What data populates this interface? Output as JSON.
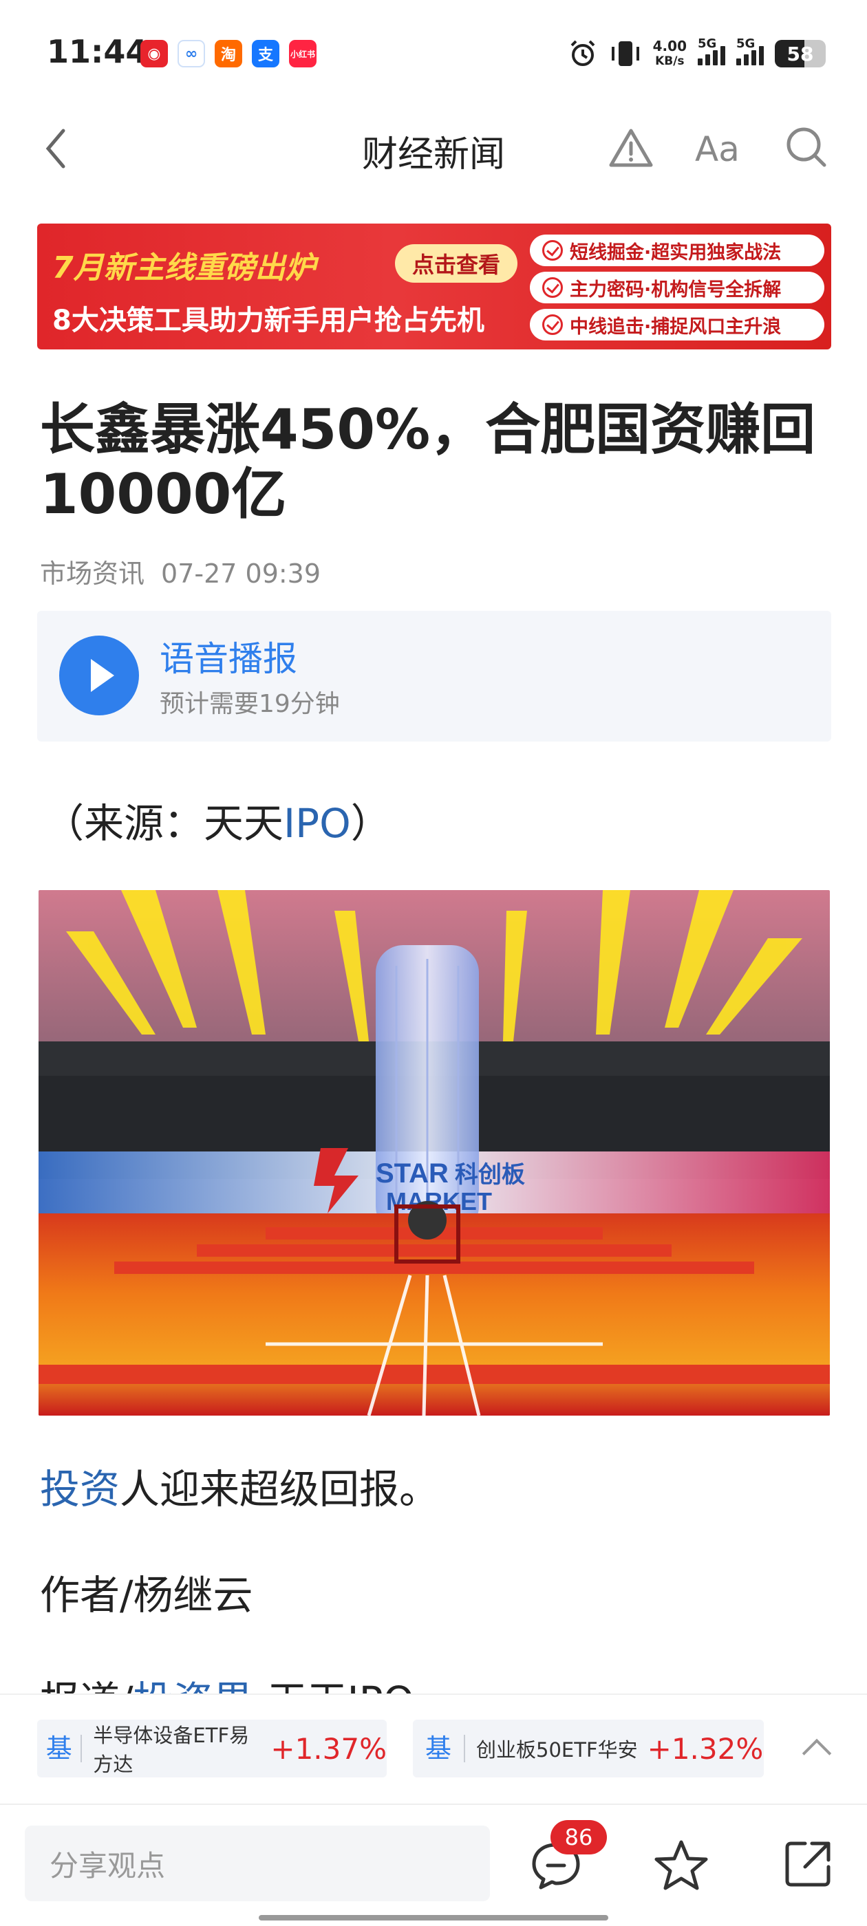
{
  "status_bar": {
    "time": "11:44",
    "apps": [
      {
        "icon": "netease-music-icon",
        "color": "#e8242c",
        "glyph": "◉"
      },
      {
        "icon": "infinity-app-icon",
        "color": "#ffffff",
        "glyph": "∞"
      },
      {
        "icon": "taobao-icon",
        "color": "#ff6a00",
        "glyph": "淘"
      },
      {
        "icon": "alipay-icon",
        "color": "#1677ff",
        "glyph": "支"
      },
      {
        "icon": "xiaohongshu-icon",
        "color": "#ff2442",
        "glyph": "小红书"
      }
    ],
    "net_speed_value": "4.00",
    "net_speed_unit": "KB/s",
    "signal1_label": "5G",
    "signal2_label": "5G",
    "battery_level": "58"
  },
  "nav": {
    "title": "财经新闻"
  },
  "banner": {
    "line1": "7月新主线重磅出炉",
    "button": "点击查看",
    "line2": "8大决策工具助力新手用户抢占先机",
    "pills": [
      "短线掘金·超实用独家战法",
      "主力密码·机构信号全拆解",
      "中线追击·捕捉风口主升浪"
    ]
  },
  "article": {
    "headline": "长鑫暴涨450%，合肥国资赚回10000亿",
    "source": "市场资讯",
    "datetime": "07-27 09:39",
    "audio_title": "语音播报",
    "audio_duration": "预计需要19分钟",
    "source_prefix": "（来源：天天",
    "source_link": "IPO",
    "source_suffix": "）",
    "photo_text_star": "STAR",
    "photo_text_kcb": "科创板",
    "photo_text_market": "MARKET",
    "p1_link": "投资",
    "p1_text": "人迎来超级回报。",
    "p2_text": "作者/杨继云",
    "p3_prefix": "报道/",
    "p3_link": "投资界",
    "p3_suffix": "-天天IPO"
  },
  "ticker": {
    "items": [
      {
        "tag": "基",
        "name": "半导体设备ETF易方达",
        "change": "+1.37%"
      },
      {
        "tag": "基",
        "name": "创业板50ETF华安",
        "change": "+1.32%"
      }
    ]
  },
  "bottom_bar": {
    "share_placeholder": "分享观点",
    "comment_count": "86"
  },
  "colors": {
    "accent_blue": "#2f7fec",
    "up_red": "#e0262a",
    "link_blue": "#2a65b0"
  }
}
